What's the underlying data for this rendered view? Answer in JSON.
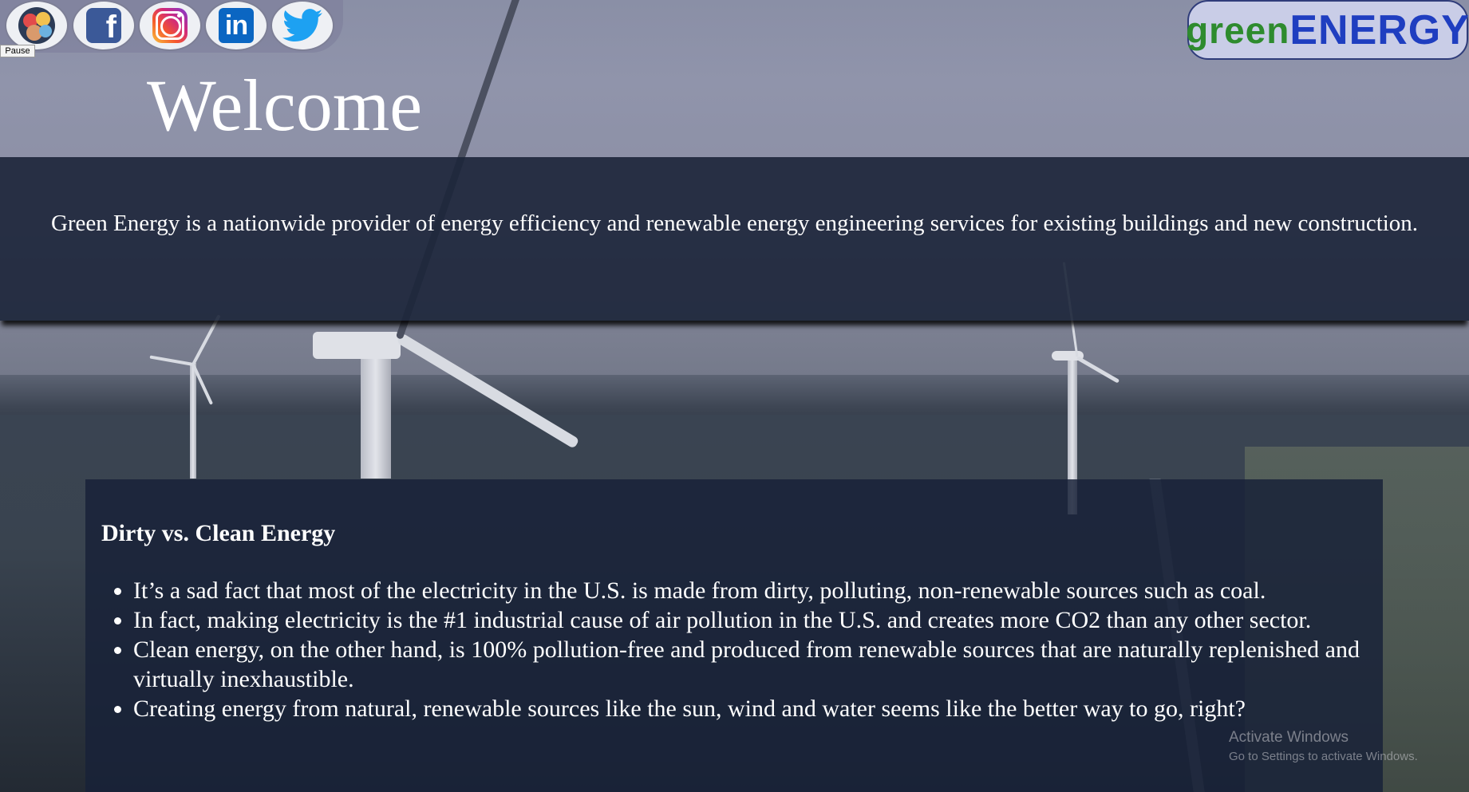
{
  "social": {
    "items": [
      {
        "name": "kids-community",
        "icon": "kids-faces-icon"
      },
      {
        "name": "facebook",
        "icon": "facebook-icon"
      },
      {
        "name": "instagram",
        "icon": "instagram-icon"
      },
      {
        "name": "linkedin",
        "icon": "linkedin-icon"
      },
      {
        "name": "twitter",
        "icon": "twitter-bird-icon"
      }
    ],
    "facebook_glyph": "f",
    "linkedin_glyph": "in"
  },
  "pause_label": "Pause",
  "logo": {
    "green": "green",
    "energy": "ENERGY"
  },
  "hero": {
    "welcome": "Welcome"
  },
  "intro": {
    "text": "Green Energy is a nationwide provider of energy efficiency and renewable energy engineering services for existing buildings and new construction."
  },
  "section": {
    "title": "Dirty vs. Clean Energy",
    "facts": [
      "It’s a sad fact that most of the electricity in the U.S. is made from dirty, polluting, non-renewable sources such as coal.",
      "In fact, making electricity is the #1 industrial cause of air pollution in the U.S. and creates more CO2 than any other sector.",
      "Clean energy, on the other hand, is 100% pollution-free and produced from renewable sources that are naturally replenished and virtually inexhaustible.",
      "Creating energy from natural, renewable sources like the sun, wind and water seems like the better way to go, right?"
    ]
  },
  "watermark": {
    "line1": "Activate Windows",
    "line2": "Go to Settings to activate Windows."
  },
  "colors": {
    "band": "#1c253a",
    "card": "#182138",
    "logo_green": "#2e8b2e",
    "logo_blue": "#1f3ec0"
  }
}
